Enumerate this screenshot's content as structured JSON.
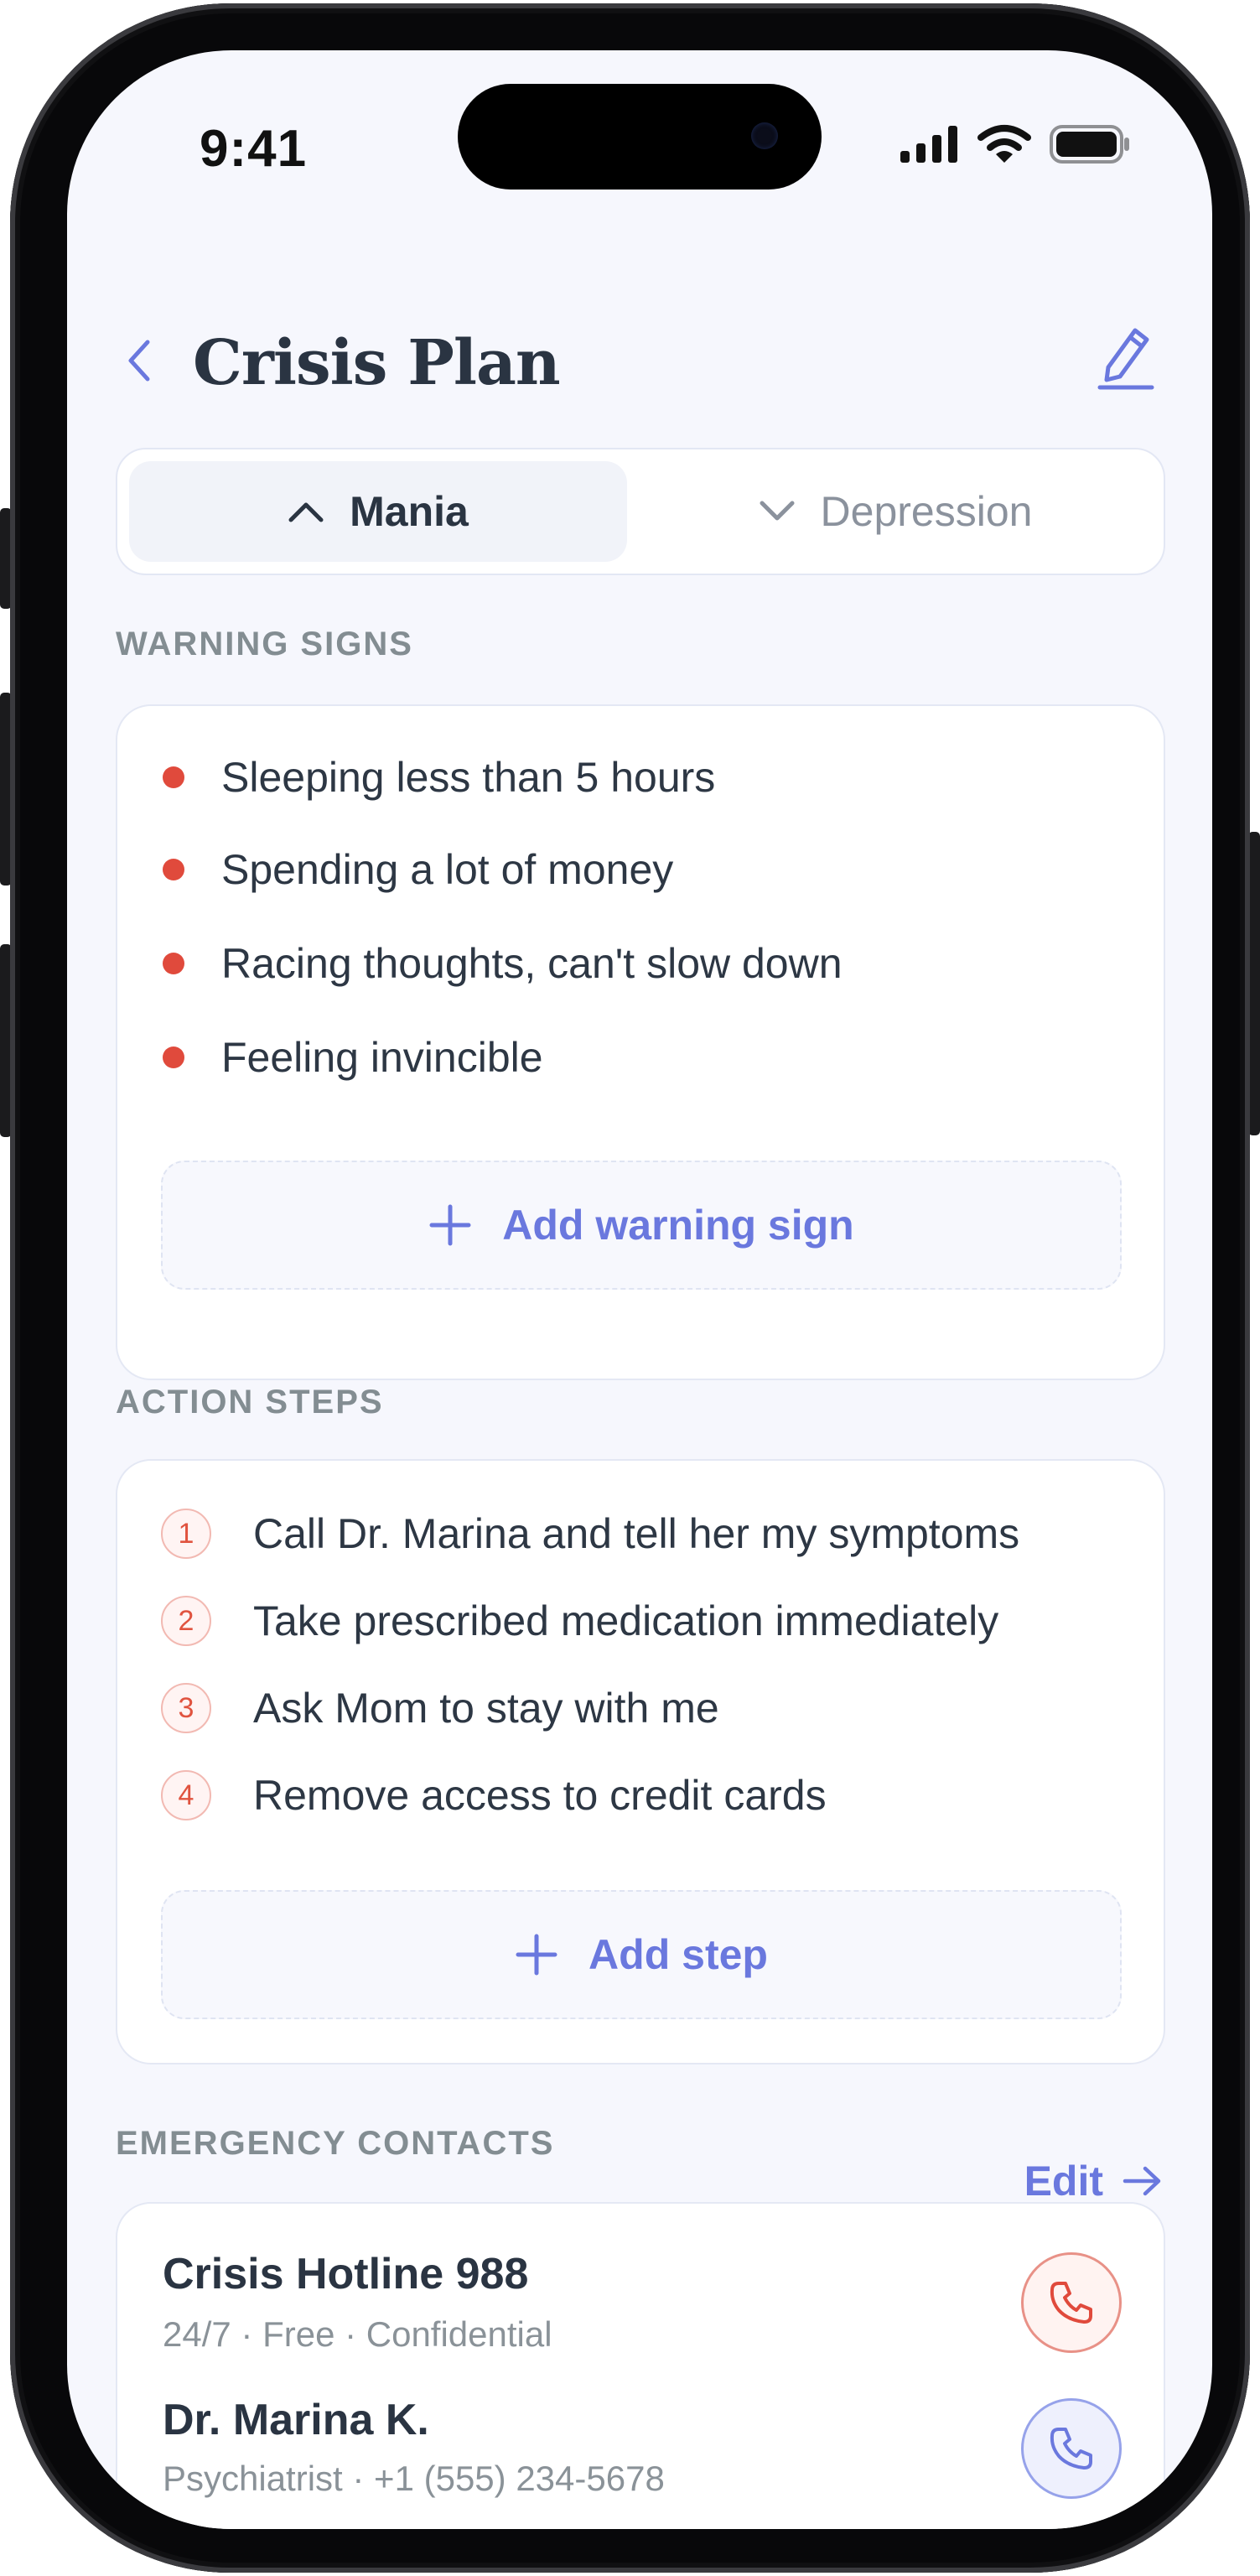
{
  "status_bar": {
    "time": "9:41"
  },
  "header": {
    "title": "Crisis Plan"
  },
  "tabs": [
    {
      "label": "Mania",
      "state": "selected"
    },
    {
      "label": "Depression",
      "state": "unselected"
    }
  ],
  "warning_signs": {
    "label": "WARNING SIGNS",
    "items": [
      "Sleeping less than 5 hours",
      "Spending a lot of money",
      "Racing thoughts, can't slow down",
      "Feeling invincible"
    ],
    "add_label": "Add warning sign"
  },
  "action_steps": {
    "label": "ACTION STEPS",
    "items": [
      {
        "num": "1",
        "text": "Call Dr. Marina and tell her my symptoms"
      },
      {
        "num": "2",
        "text": "Take prescribed medication immediately"
      },
      {
        "num": "3",
        "text": "Ask Mom to stay with me"
      },
      {
        "num": "4",
        "text": "Remove access to credit cards"
      }
    ],
    "add_label": "Add step"
  },
  "emergency_contacts": {
    "label": "EMERGENCY CONTACTS",
    "edit_label": "Edit",
    "items": [
      {
        "name": "Crisis Hotline 988",
        "detail": "24/7 · Free · Confidential",
        "accent": "#e04a3c"
      },
      {
        "name": "Dr. Marina K.",
        "detail": "Psychiatrist · +1 (555) 234-5678",
        "accent": "#6a78de"
      }
    ]
  },
  "colors": {
    "accent": "#6a78de",
    "danger": "#e04a3c",
    "title": "#2a3442",
    "background": "#f6f7fd"
  }
}
